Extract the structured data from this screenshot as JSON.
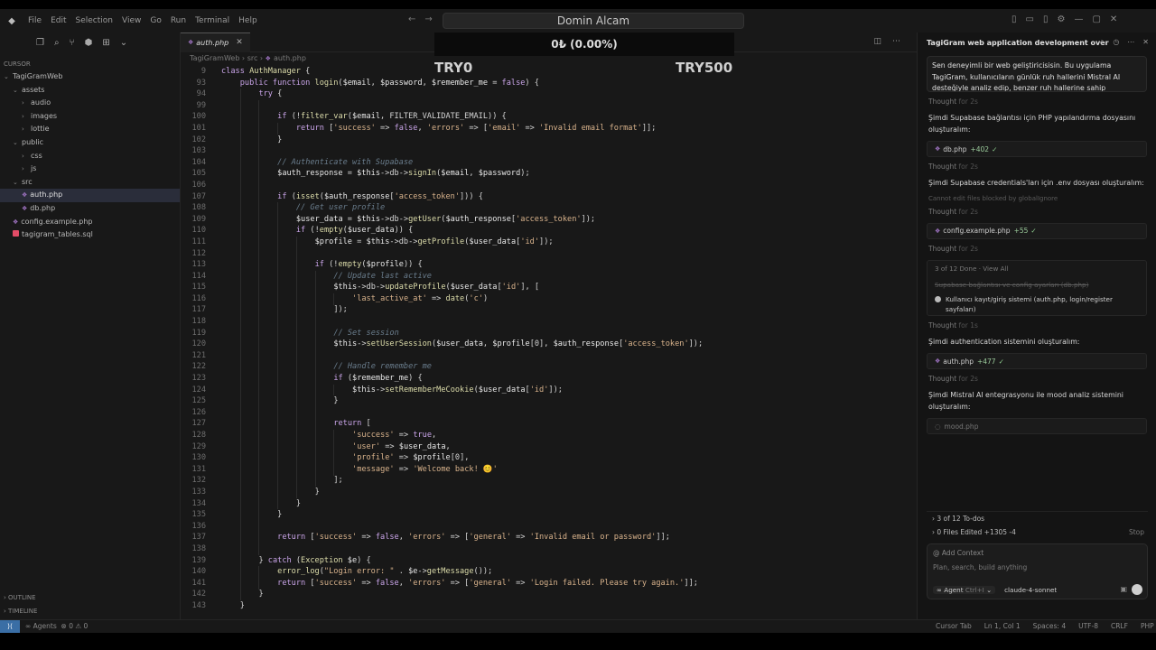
{
  "overlay": {
    "title": "Domin Alcam",
    "ticker": "0₺ (0.00%)",
    "left_label": "TRY0",
    "right_label": "TRY500"
  },
  "menu": [
    "File",
    "Edit",
    "Selection",
    "View",
    "Go",
    "Run",
    "Terminal",
    "Help"
  ],
  "sidebar": {
    "section_title": "CURSOR",
    "tree": [
      {
        "label": "TagiGramWeb",
        "depth": 0,
        "type": "folder",
        "open": true
      },
      {
        "label": "assets",
        "depth": 1,
        "type": "folder",
        "open": true
      },
      {
        "label": "audio",
        "depth": 2,
        "type": "folder",
        "open": false
      },
      {
        "label": "images",
        "depth": 2,
        "type": "folder",
        "open": false
      },
      {
        "label": "lottie",
        "depth": 2,
        "type": "folder",
        "open": false
      },
      {
        "label": "public",
        "depth": 1,
        "type": "folder",
        "open": true
      },
      {
        "label": "css",
        "depth": 2,
        "type": "folder",
        "open": false
      },
      {
        "label": "js",
        "depth": 2,
        "type": "folder",
        "open": false
      },
      {
        "label": "src",
        "depth": 1,
        "type": "folder",
        "open": true
      },
      {
        "label": "auth.php",
        "depth": 2,
        "type": "php",
        "active": true
      },
      {
        "label": "db.php",
        "depth": 2,
        "type": "php"
      },
      {
        "label": "config.example.php",
        "depth": 1,
        "type": "php"
      },
      {
        "label": "tagigram_tables.sql",
        "depth": 1,
        "type": "sql"
      }
    ],
    "outline": "OUTLINE",
    "timeline": "TIMELINE"
  },
  "editor": {
    "tab_label": "auth.php",
    "breadcrumb": [
      "TagiGramWeb",
      "src",
      "auth.php"
    ],
    "lines": [
      {
        "n": "9",
        "i": 0,
        "h": "<span class='kw'>class</span> <span class='fn'>AuthManager</span> {"
      },
      {
        "n": "93",
        "i": 1,
        "h": "<span class='kw'>public function</span> <span class='fn'>login</span>(<span class='var'>$email</span>, <span class='var'>$password</span>, <span class='var'>$remember_me</span> = <span class='kw'>false</span>) {"
      },
      {
        "n": "94",
        "i": 2,
        "h": "<span class='kw'>try</span> {"
      },
      {
        "n": "99",
        "i": 3,
        "h": ""
      },
      {
        "n": "100",
        "i": 3,
        "h": "<span class='kw'>if</span> (!<span class='fn'>filter_var</span>(<span class='var'>$email</span>, FILTER_VALIDATE_EMAIL)) {"
      },
      {
        "n": "101",
        "i": 4,
        "h": "<span class='kw'>return</span> [<span class='str'>'success'</span> => <span class='kw'>false</span>, <span class='str'>'errors'</span> => [<span class='str'>'email'</span> => <span class='str'>'Invalid email format'</span>]];"
      },
      {
        "n": "102",
        "i": 3,
        "h": "}"
      },
      {
        "n": "103",
        "i": 3,
        "h": ""
      },
      {
        "n": "104",
        "i": 3,
        "h": "<span class='cm'>// Authenticate with Supabase</span>"
      },
      {
        "n": "105",
        "i": 3,
        "h": "<span class='var'>$auth_response</span> = <span class='var'>$this</span>->db-><span class='fn'>signIn</span>(<span class='var'>$email</span>, <span class='var'>$password</span>);"
      },
      {
        "n": "106",
        "i": 3,
        "h": ""
      },
      {
        "n": "107",
        "i": 3,
        "h": "<span class='kw'>if</span> (<span class='fn'>isset</span>(<span class='var'>$auth_response</span>[<span class='str'>'access_token'</span>])) {"
      },
      {
        "n": "108",
        "i": 4,
        "h": "<span class='cm'>// Get user profile</span>"
      },
      {
        "n": "109",
        "i": 4,
        "h": "<span class='var'>$user_data</span> = <span class='var'>$this</span>->db-><span class='fn'>getUser</span>(<span class='var'>$auth_response</span>[<span class='str'>'access_token'</span>]);"
      },
      {
        "n": "110",
        "i": 4,
        "h": "<span class='kw'>if</span> (!<span class='fn'>empty</span>(<span class='var'>$user_data</span>)) {"
      },
      {
        "n": "111",
        "i": 5,
        "h": "<span class='var'>$profile</span> = <span class='var'>$this</span>->db-><span class='fn'>getProfile</span>(<span class='var'>$user_data</span>[<span class='str'>'id'</span>]);"
      },
      {
        "n": "112",
        "i": 5,
        "h": ""
      },
      {
        "n": "113",
        "i": 5,
        "h": "<span class='kw'>if</span> (!<span class='fn'>empty</span>(<span class='var'>$profile</span>)) {"
      },
      {
        "n": "114",
        "i": 6,
        "h": "<span class='cm'>// Update last active</span>"
      },
      {
        "n": "115",
        "i": 6,
        "h": "<span class='var'>$this</span>->db-><span class='fn'>updateProfile</span>(<span class='var'>$user_data</span>[<span class='str'>'id'</span>], ["
      },
      {
        "n": "116",
        "i": 7,
        "h": "<span class='str'>'last_active_at'</span> => <span class='fn'>date</span>(<span class='str'>'c'</span>)"
      },
      {
        "n": "117",
        "i": 6,
        "h": "]);"
      },
      {
        "n": "118",
        "i": 6,
        "h": ""
      },
      {
        "n": "119",
        "i": 6,
        "h": "<span class='cm'>// Set session</span>"
      },
      {
        "n": "120",
        "i": 6,
        "h": "<span class='var'>$this</span>-><span class='fn'>setUserSession</span>(<span class='var'>$user_data</span>, <span class='var'>$profile</span>[0], <span class='var'>$auth_response</span>[<span class='str'>'access_token'</span>]);"
      },
      {
        "n": "121",
        "i": 6,
        "h": ""
      },
      {
        "n": "122",
        "i": 6,
        "h": "<span class='cm'>// Handle remember me</span>"
      },
      {
        "n": "123",
        "i": 6,
        "h": "<span class='kw'>if</span> (<span class='var'>$remember_me</span>) {"
      },
      {
        "n": "124",
        "i": 7,
        "h": "<span class='var'>$this</span>-><span class='fn'>setRememberMeCookie</span>(<span class='var'>$user_data</span>[<span class='str'>'id'</span>]);"
      },
      {
        "n": "125",
        "i": 6,
        "h": "}"
      },
      {
        "n": "126",
        "i": 6,
        "h": ""
      },
      {
        "n": "127",
        "i": 6,
        "h": "<span class='kw'>return</span> ["
      },
      {
        "n": "128",
        "i": 7,
        "h": "<span class='str'>'success'</span> => <span class='kw'>true</span>,"
      },
      {
        "n": "129",
        "i": 7,
        "h": "<span class='str'>'user'</span> => <span class='var'>$user_data</span>,"
      },
      {
        "n": "130",
        "i": 7,
        "h": "<span class='str'>'profile'</span> => <span class='var'>$profile</span>[0],"
      },
      {
        "n": "131",
        "i": 7,
        "h": "<span class='str'>'message'</span> => <span class='str'>'Welcome back! 😊'</span>"
      },
      {
        "n": "132",
        "i": 6,
        "h": "];"
      },
      {
        "n": "133",
        "i": 5,
        "h": "}"
      },
      {
        "n": "134",
        "i": 4,
        "h": "}"
      },
      {
        "n": "135",
        "i": 3,
        "h": "}"
      },
      {
        "n": "136",
        "i": 3,
        "h": ""
      },
      {
        "n": "137",
        "i": 3,
        "h": "<span class='kw'>return</span> [<span class='str'>'success'</span> => <span class='kw'>false</span>, <span class='str'>'errors'</span> => [<span class='str'>'general'</span> => <span class='str'>'Invalid email or password'</span>]];"
      },
      {
        "n": "138",
        "i": 3,
        "h": ""
      },
      {
        "n": "139",
        "i": 2,
        "h": "} <span class='kw'>catch</span> (<span class='fn'>Exception</span> <span class='var'>$e</span>) {"
      },
      {
        "n": "140",
        "i": 3,
        "h": "<span class='fn'>error_log</span>(<span class='str'>\"Login error: \"</span> . <span class='var'>$e</span>-><span class='fn'>getMessage</span>());"
      },
      {
        "n": "141",
        "i": 3,
        "h": "<span class='kw'>return</span> [<span class='str'>'success'</span> => <span class='kw'>false</span>, <span class='str'>'errors'</span> => [<span class='str'>'general'</span> => <span class='str'>'Login failed. Please try again.'</span>]];"
      },
      {
        "n": "142",
        "i": 2,
        "h": "}"
      },
      {
        "n": "143",
        "i": 1,
        "h": "}"
      }
    ]
  },
  "chat": {
    "title": "TagiGram web application development over",
    "user_message": "Sen deneyimli bir web geliştiricisisin. Bu uygulama TagiGram, kullanıcıların günlük ruh hallerini Mistral AI desteğiyle analiz edip, benzer ruh hallerine sahip",
    "thought_label": "Thought",
    "thought_for": "for 2s",
    "thought_for_1": "for 1s",
    "msg_db": "Şimdi Supabase bağlantısı için PHP yapılandırma dosyasını oluşturalım:",
    "chip_db": {
      "file": "db.php",
      "delta": "+402"
    },
    "msg_env": "Şimdi Supabase credentials'ları için .env dosyası oluşturalım:",
    "blocked_note": "Cannot edit files blocked by globalIgnore",
    "chip_config": {
      "file": "config.example.php",
      "delta": "+55"
    },
    "todo_header": "3 of 12 Done · View All",
    "todo_done": "Supabase bağlantısı ve config ayarları (db.php)",
    "todo_current": "Kullanıcı kayıt/giriş sistemi (auth.php, login/register sayfaları)",
    "msg_auth": "Şimdi authentication sistemini oluşturalım:",
    "chip_auth": {
      "file": "auth.php",
      "delta": "+477"
    },
    "msg_mood": "Şimdi Mistral AI entegrasyonu ile mood analiz sistemini oluşturalım:",
    "chip_mood": {
      "file": "mood.php"
    },
    "todo_summary": "3 of 12 To-dos",
    "files_edited": "0 Files Edited +1305 -4",
    "stop_label": "Stop",
    "add_context": "@ Add Context",
    "input_placeholder": "Plan, search, build anything",
    "agent_label": "Agent",
    "agent_shortcut": "Ctrl+I",
    "model_label": "claude-4-sonnet"
  },
  "statusbar": {
    "agents": "Agents",
    "problems": "⊗ 0 ⚠ 0",
    "cursor_tab": "Cursor Tab",
    "position": "Ln 1, Col 1",
    "spaces": "Spaces: 4",
    "encoding": "UTF-8",
    "eol": "CRLF",
    "language": "PHP"
  }
}
